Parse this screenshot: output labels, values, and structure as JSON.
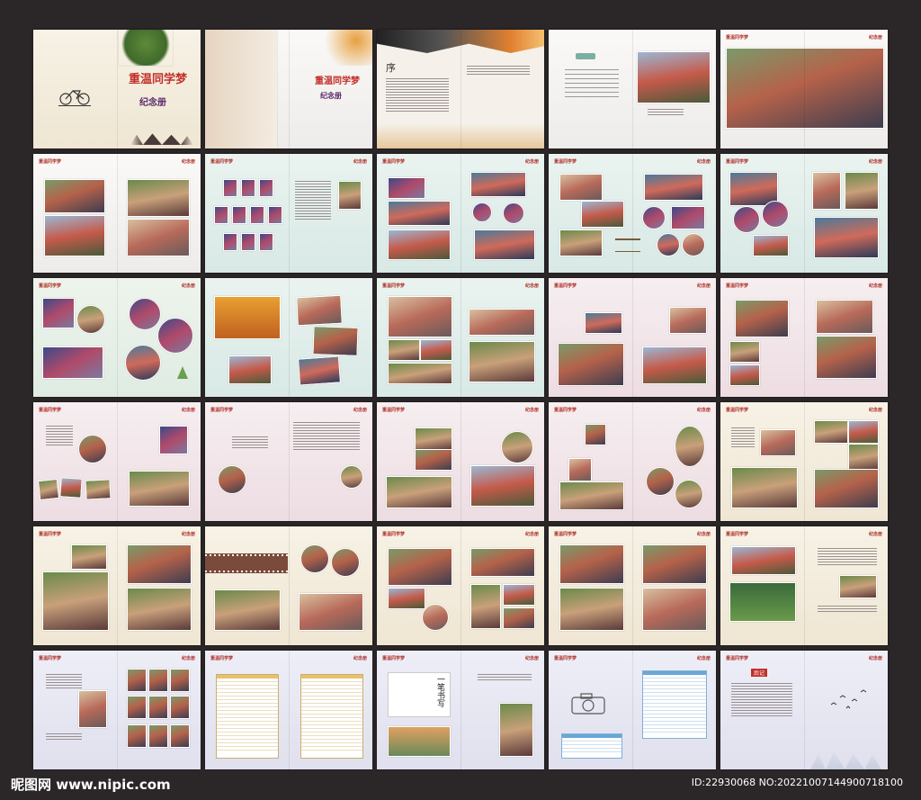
{
  "cover": {
    "title": "重温同学梦",
    "subtitle": "纪念册"
  },
  "inner_cover": {
    "title": "重温同学梦",
    "subtitle": "纪念册"
  },
  "preface": {
    "title": "序"
  },
  "header_left": "重温同学梦",
  "header_right": "纪念册",
  "calligraphy": "一笔书写",
  "afterword": "后记",
  "watermark": {
    "site": "昵图网 www.nipic.com",
    "id": "ID:22930068 NO:20221007144900718100"
  }
}
